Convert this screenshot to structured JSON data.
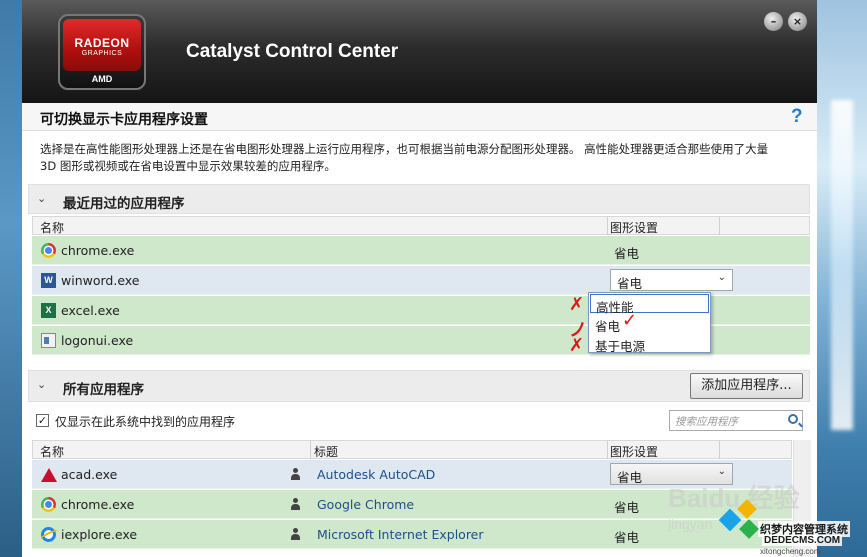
{
  "header": {
    "logo": {
      "brand": "RADEON",
      "sub": "GRAPHICS",
      "maker": "AMD"
    },
    "app_title": "Catalyst Control Center"
  },
  "page": {
    "title": "可切换显示卡应用程序设置",
    "help": "?",
    "description_line1": "选择是在高性能图形处理器上还是在省电图形处理器上运行应用程序，也可根据当前电源分配图形处理器。 高性能处理器更适合那些使用了大量",
    "description_line2": "3D 图形或视频或在省电设置中显示效果较差的应用程序。"
  },
  "recent": {
    "title": "最近用过的应用程序",
    "col_name": "名称",
    "col_graphics": "图形设置",
    "rows": [
      {
        "name": "chrome.exe",
        "setting": "省电",
        "icon": "chrome-icon"
      },
      {
        "name": "winword.exe",
        "setting": "省电",
        "icon": "word-icon"
      },
      {
        "name": "excel.exe",
        "setting": "",
        "icon": "excel-icon"
      },
      {
        "name": "logonui.exe",
        "setting": "",
        "icon": "logonui-icon"
      }
    ],
    "dropdown_options": [
      "高性能",
      "省电",
      "基于电源"
    ]
  },
  "all": {
    "title": "所有应用程序",
    "add_button": "添加应用程序...",
    "only_found_label": "仅显示在此系统中找到的应用程序",
    "only_found_checked": true,
    "search_placeholder": "搜索应用程序",
    "col_name": "名称",
    "col_title": "标题",
    "col_graphics": "图形设置",
    "rows": [
      {
        "name": "acad.exe",
        "title": "Autodesk AutoCAD",
        "setting": "省电",
        "icon": "autocad-icon"
      },
      {
        "name": "chrome.exe",
        "title": "Google Chrome",
        "setting": "省电",
        "icon": "chrome-icon"
      },
      {
        "name": "iexplore.exe",
        "title": "Microsoft Internet Explorer",
        "setting": "省电",
        "icon": "ie-icon"
      }
    ]
  },
  "watermarks": {
    "baidu": "Baidu 经验",
    "jingyan": "jingyan",
    "site_cn": "织梦内容管理系统",
    "site_url": "DEDECMS.COM",
    "xitong": "xitongcheng.com"
  },
  "colors": {
    "row_green": "#cfe8cb",
    "row_selected": "#dfe7f0",
    "header_dark": "#1a1a1a",
    "logo_red": "#c8141c",
    "annotation_red": "#e01515"
  }
}
